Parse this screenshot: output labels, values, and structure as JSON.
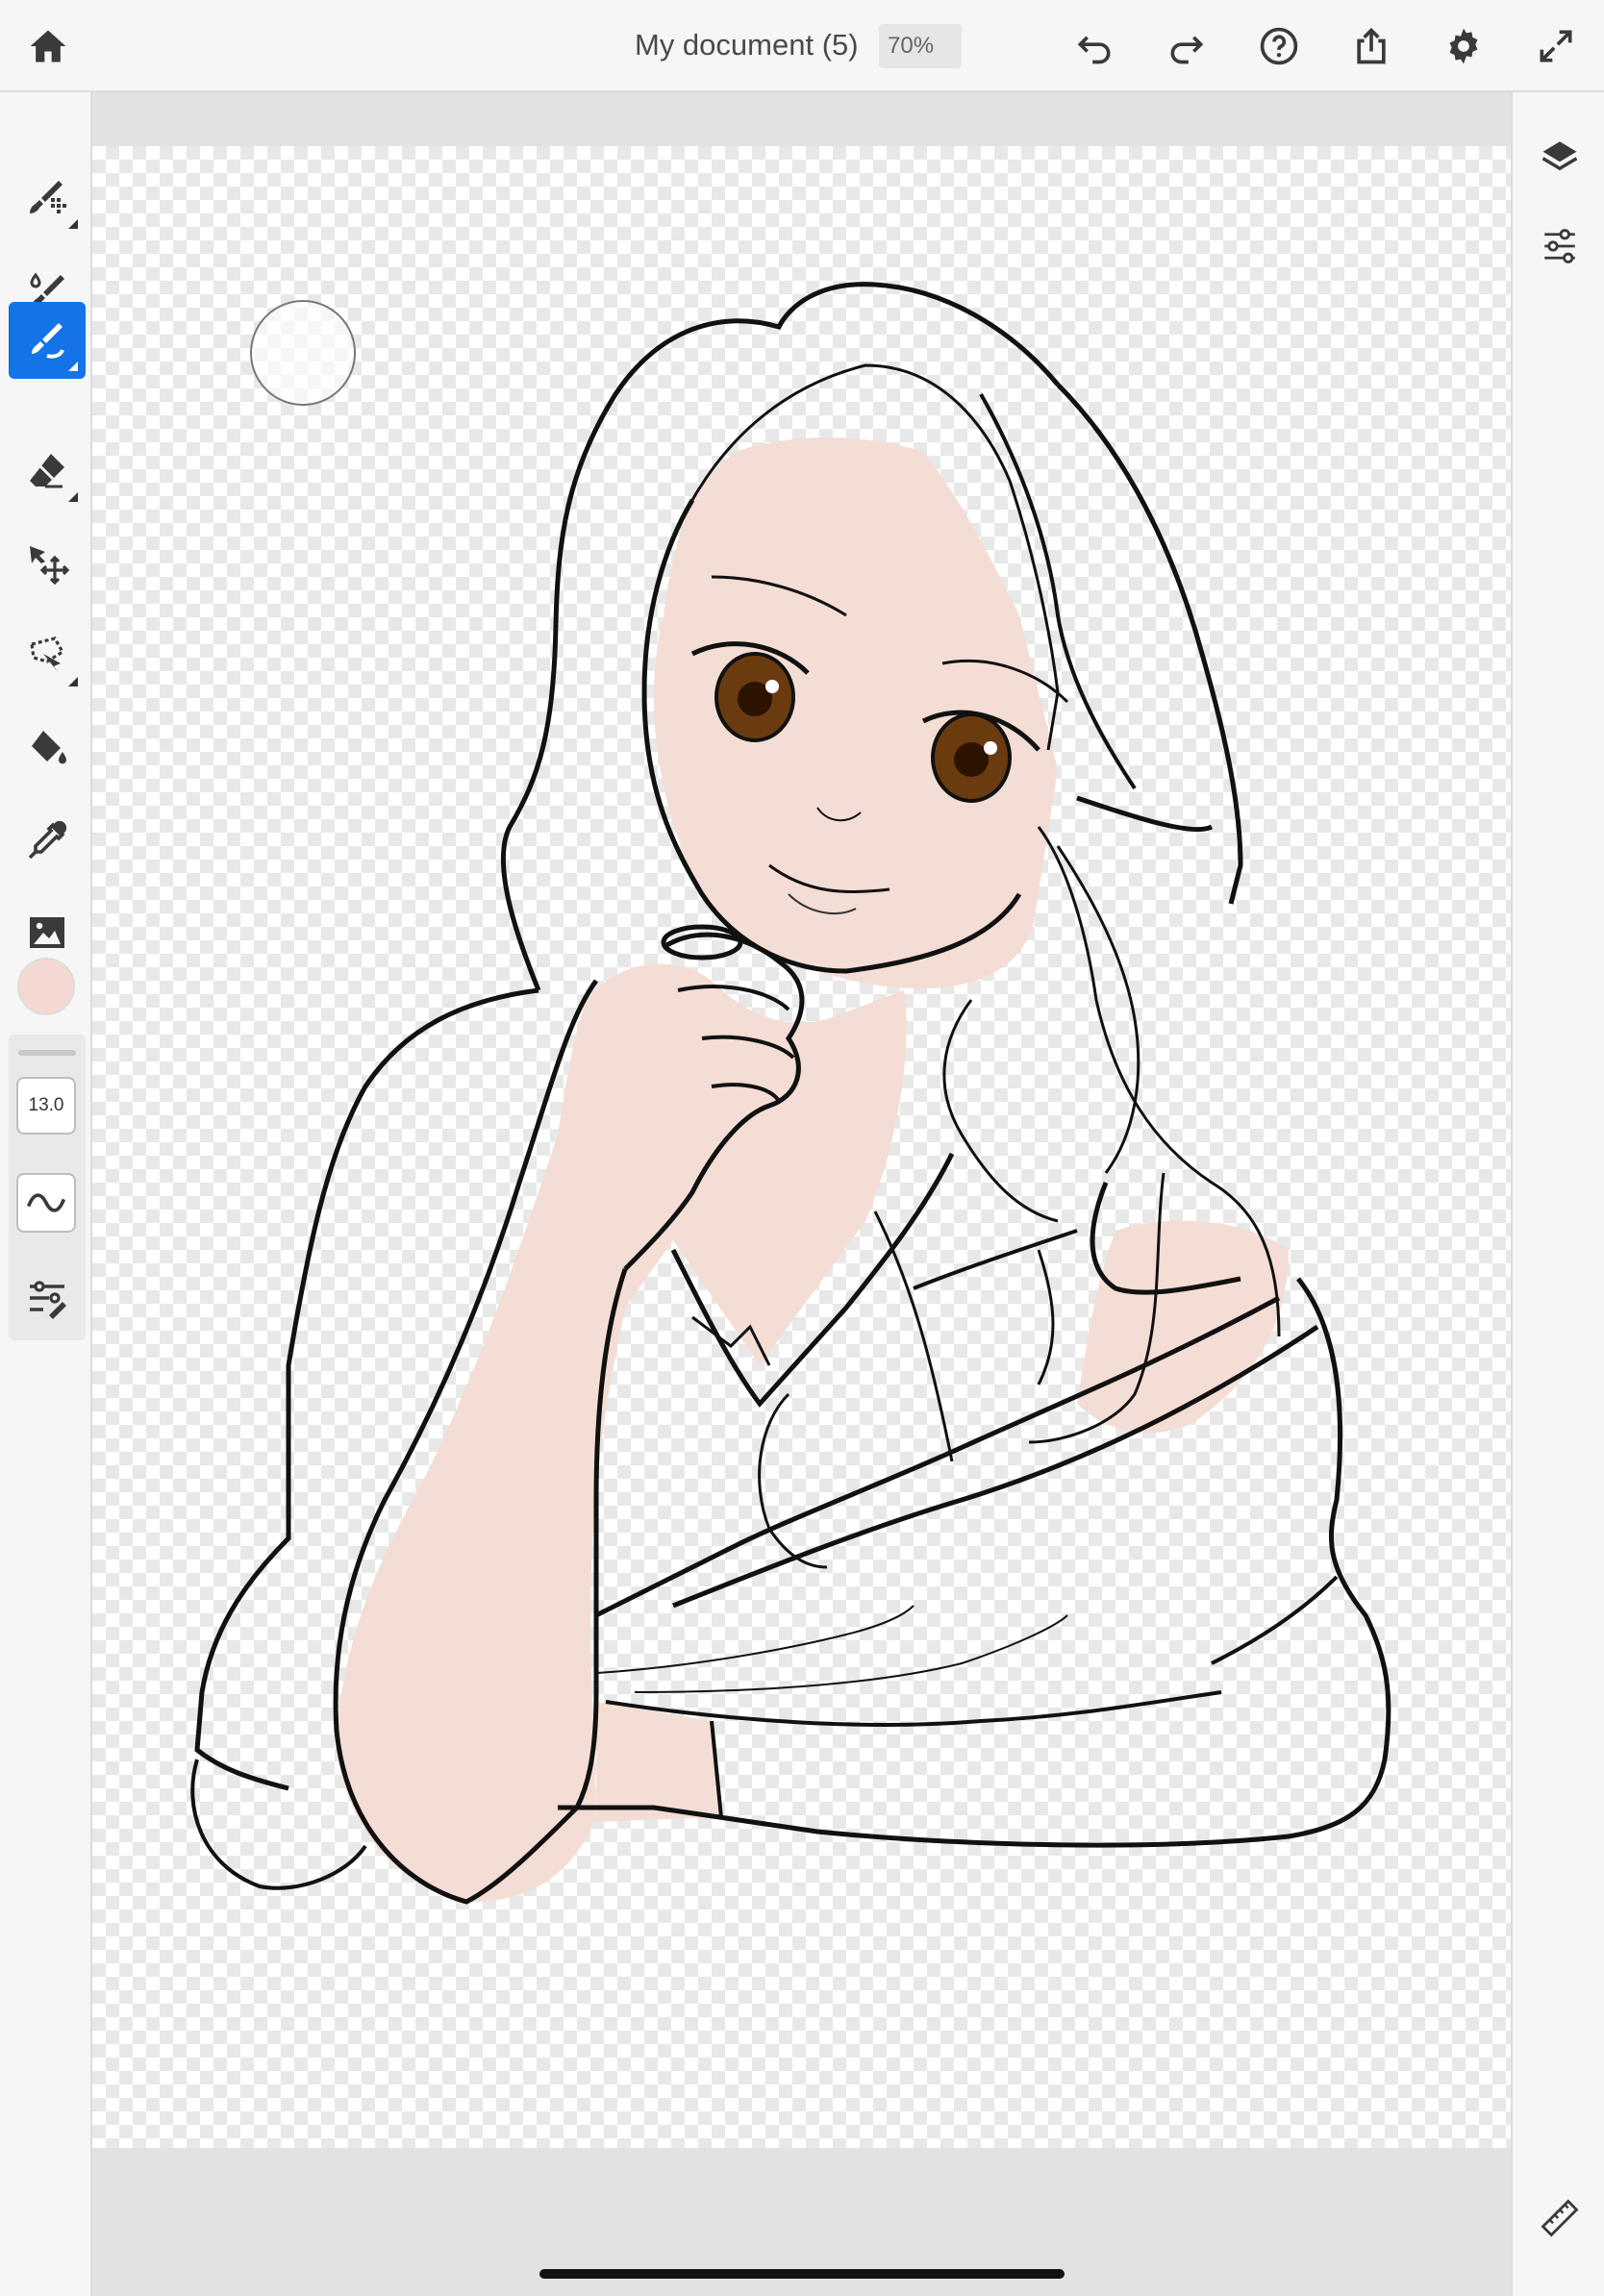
{
  "header": {
    "title": "My document (5)",
    "zoom": "70%",
    "buttons": [
      "home-icon",
      "undo-icon",
      "redo-icon",
      "help-icon",
      "share-icon",
      "settings-icon",
      "fullscreen-icon"
    ]
  },
  "toolbar": {
    "tools": [
      {
        "name": "pixel-brush",
        "icon": "pixel-brush-icon"
      },
      {
        "name": "live-brush",
        "icon": "live-brush-icon"
      },
      {
        "name": "vector-brush",
        "icon": "vector-brush-icon",
        "active": true
      },
      {
        "name": "eraser",
        "icon": "eraser-icon"
      },
      {
        "name": "transform",
        "icon": "transform-icon"
      },
      {
        "name": "lasso",
        "icon": "lasso-icon"
      },
      {
        "name": "fill",
        "icon": "fill-bucket-icon"
      },
      {
        "name": "eyedropper",
        "icon": "eyedropper-icon"
      },
      {
        "name": "place-image",
        "icon": "image-icon"
      }
    ],
    "current_color": "#f4d9d2",
    "brush_size": "13.0",
    "accent_color": "#1473e6"
  },
  "right_panel": {
    "buttons": [
      "layers-icon",
      "adjustments-icon",
      "ruler-icon"
    ]
  }
}
